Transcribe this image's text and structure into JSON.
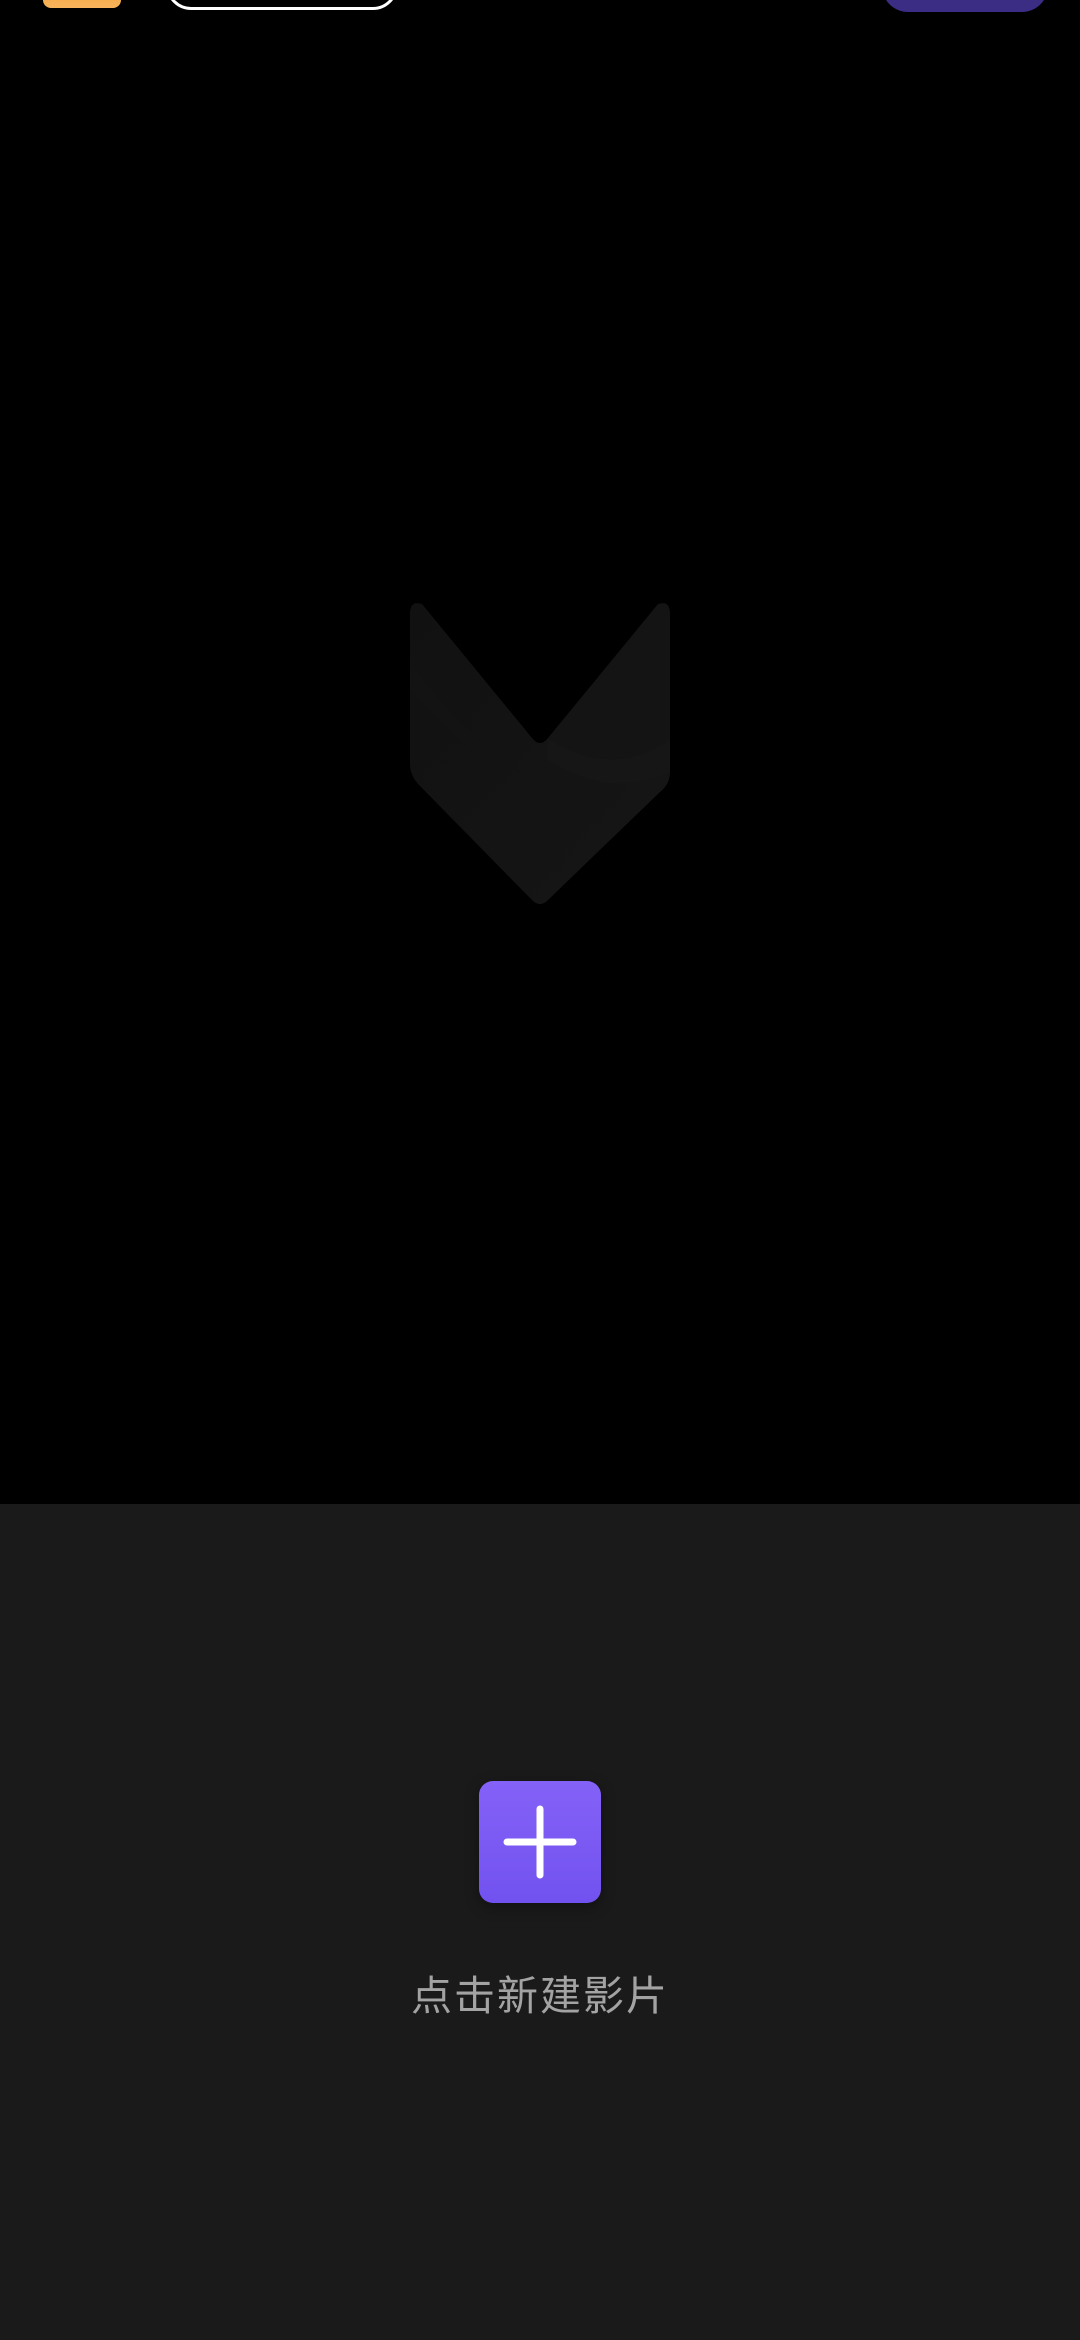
{
  "top_bar": {
    "badge_color": "#f6a43f",
    "outline_pill_color": "#ffffff",
    "action_pill_color": "#3c2d84"
  },
  "preview": {
    "background_color": "#000000",
    "watermark_icon": "app-logo-chevron-icon"
  },
  "create_panel": {
    "background_color": "#1a1a1a",
    "add_icon": "plus-icon",
    "add_button_color": "#7d5cf6",
    "label": "点击新建影片"
  }
}
